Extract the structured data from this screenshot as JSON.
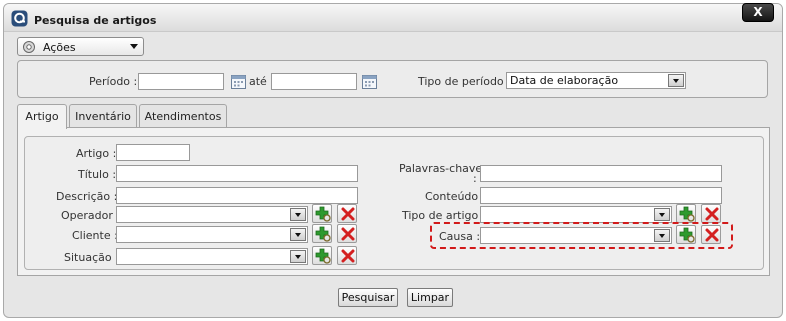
{
  "window": {
    "title": "Pesquisa de artigos",
    "close_label": "X"
  },
  "actions": {
    "label": "Ações"
  },
  "period": {
    "label": "Período :",
    "from_value": "",
    "to_label": "até",
    "to_value": "",
    "type_label": "Tipo de período :",
    "type_value": "Data de elaboração"
  },
  "tabs": [
    {
      "label": "Artigo",
      "active": true
    },
    {
      "label": "Inventário",
      "active": false
    },
    {
      "label": "Atendimentos",
      "active": false
    }
  ],
  "form": {
    "artigo": {
      "label": "Artigo :",
      "value": ""
    },
    "titulo": {
      "label": "Título :",
      "value": ""
    },
    "descricao": {
      "label": "Descrição :",
      "value": ""
    },
    "operador": {
      "label": "Operador :",
      "value": ""
    },
    "cliente": {
      "label": "Cliente :",
      "value": ""
    },
    "situacao": {
      "label": "Situação :",
      "value": ""
    },
    "palavras_chave": {
      "label_line1": "Palavras-chave",
      "label_line2": ":",
      "value": ""
    },
    "conteudo": {
      "label": "Conteúdo :",
      "value": ""
    },
    "tipo_artigo": {
      "label": "Tipo de artigo :",
      "value": ""
    },
    "causa": {
      "label": "Causa :",
      "value": ""
    }
  },
  "buttons": {
    "search": "Pesquisar",
    "clear": "Limpar"
  },
  "colors": {
    "highlight": "#d21a1a",
    "add_green": "#2e9a2e",
    "delete_red": "#d42020"
  }
}
